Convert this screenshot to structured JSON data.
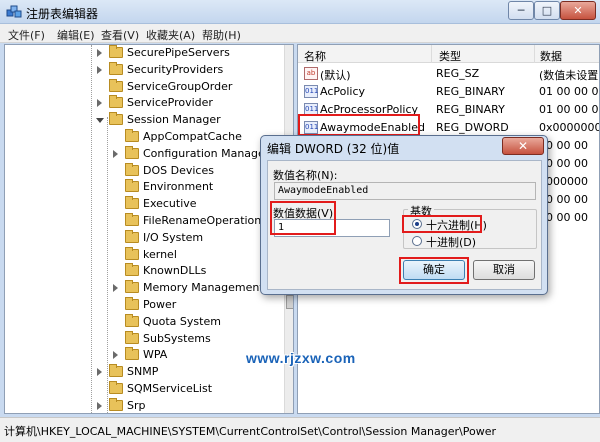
{
  "window": {
    "title": "注册表编辑器",
    "minimize_glyph": "─",
    "maximize_glyph": "□",
    "close_glyph": "✕"
  },
  "menu": [
    "文件(F)",
    "编辑(E)",
    "查看(V)",
    "收藏夹(A)",
    "帮助(H)"
  ],
  "tree": {
    "items": [
      {
        "label": "SecurePipeServers",
        "level": 1,
        "expander": "closed"
      },
      {
        "label": "SecurityProviders",
        "level": 1,
        "expander": "closed"
      },
      {
        "label": "ServiceGroupOrder",
        "level": 1,
        "expander": "none"
      },
      {
        "label": "ServiceProvider",
        "level": 1,
        "expander": "closed"
      },
      {
        "label": "Session Manager",
        "level": 1,
        "expander": "open"
      },
      {
        "label": "AppCompatCache",
        "level": 2,
        "expander": "none"
      },
      {
        "label": "Configuration Manager",
        "level": 2,
        "expander": "closed"
      },
      {
        "label": "DOS Devices",
        "level": 2,
        "expander": "none"
      },
      {
        "label": "Environment",
        "level": 2,
        "expander": "none"
      },
      {
        "label": "Executive",
        "level": 2,
        "expander": "none"
      },
      {
        "label": "FileRenameOperations",
        "level": 2,
        "expander": "none"
      },
      {
        "label": "I/O System",
        "level": 2,
        "expander": "none"
      },
      {
        "label": "kernel",
        "level": 2,
        "expander": "none"
      },
      {
        "label": "KnownDLLs",
        "level": 2,
        "expander": "none"
      },
      {
        "label": "Memory Management",
        "level": 2,
        "expander": "closed"
      },
      {
        "label": "Power",
        "level": 2,
        "expander": "none",
        "selected": true
      },
      {
        "label": "Quota System",
        "level": 2,
        "expander": "none"
      },
      {
        "label": "SubSystems",
        "level": 2,
        "expander": "none"
      },
      {
        "label": "WPA",
        "level": 2,
        "expander": "closed"
      },
      {
        "label": "SNMP",
        "level": 1,
        "expander": "closed"
      },
      {
        "label": "SQMServiceList",
        "level": 1,
        "expander": "none"
      },
      {
        "label": "Srp",
        "level": 1,
        "expander": "closed"
      }
    ]
  },
  "list": {
    "columns": {
      "name": "名称",
      "type": "类型",
      "data": "数据"
    },
    "rows": [
      {
        "name": "(默认)",
        "type": "REG_SZ",
        "data": "(数值未设置)",
        "icon": "ab"
      },
      {
        "name": "AcPolicy",
        "type": "REG_BINARY",
        "data": "01 00 00 00",
        "icon": "011"
      },
      {
        "name": "AcProcessorPolicy",
        "type": "REG_BINARY",
        "data": "01 00 00 00",
        "icon": "011"
      },
      {
        "name": "AwaymodeEnabled",
        "type": "REG_DWORD",
        "data": "0x0000000",
        "icon": "011"
      },
      {
        "name": "",
        "type": "",
        "data": "00 00 00",
        "icon": "011"
      },
      {
        "name": "",
        "type": "",
        "data": "00 00 00",
        "icon": "011"
      },
      {
        "name": "",
        "type": "",
        "data": "0000000",
        "icon": "011"
      },
      {
        "name": "",
        "type": "",
        "data": "00 00 00",
        "icon": "011"
      },
      {
        "name": "",
        "type": "",
        "data": "00 00 00",
        "icon": "011"
      }
    ]
  },
  "dialog": {
    "title": "编辑 DWORD (32 位)值",
    "close_glyph": "✕",
    "value_name_label": "数值名称(N):",
    "value_name": "AwaymodeEnabled",
    "value_data_label": "数值数据(V):",
    "value_data": "1",
    "base_label": "基数",
    "hex_label": "十六进制(H)",
    "dec_label": "十进制(D)",
    "selected_base": "hex",
    "ok_label": "确定",
    "cancel_label": "取消"
  },
  "watermark": "www.rjzxw.com",
  "status": "计算机\\HKEY_LOCAL_MACHINE\\SYSTEM\\CurrentControlSet\\Control\\Session Manager\\Power",
  "colors": {
    "annotation": "#e21b1b",
    "watermark": "#1a63b8"
  }
}
